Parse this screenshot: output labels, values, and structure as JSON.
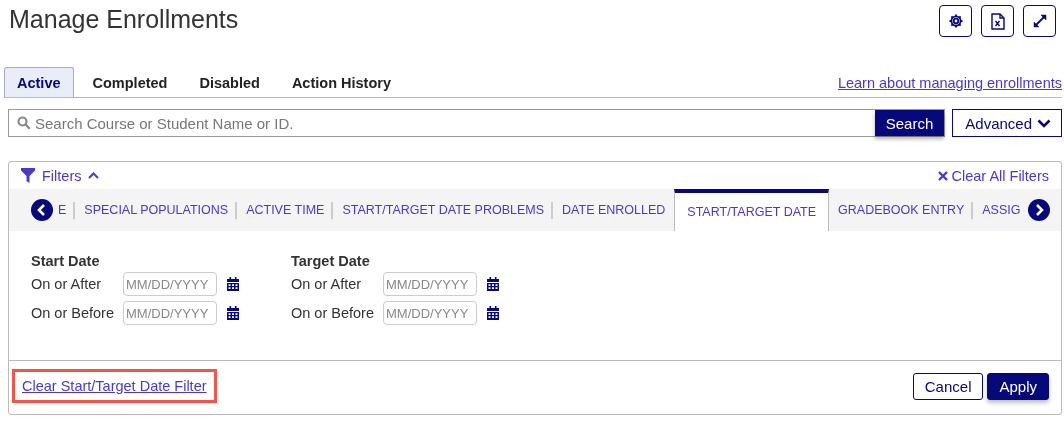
{
  "title": "Manage Enrollments",
  "toolbar": [
    {
      "kind": "settings"
    },
    {
      "kind": "excel"
    },
    {
      "kind": "expand"
    }
  ],
  "tabs": [
    {
      "label": "Active",
      "selected": true
    },
    {
      "label": "Completed",
      "selected": false
    },
    {
      "label": "Disabled",
      "selected": false
    },
    {
      "label": "Action History",
      "selected": false
    }
  ],
  "help_link": "Learn about managing enrollments",
  "search": {
    "placeholder": "Search Course or Student Name or ID.",
    "button": "Search",
    "advanced": "Advanced"
  },
  "filters": {
    "label": "Filters",
    "expanded": true,
    "clear_all": "Clear All Filters",
    "tabs": [
      {
        "label": "E",
        "selected": false
      },
      {
        "label": "SPECIAL POPULATIONS",
        "selected": false
      },
      {
        "label": "ACTIVE TIME",
        "selected": false
      },
      {
        "label": "START/TARGET DATE PROBLEMS",
        "selected": false
      },
      {
        "label": "DATE ENROLLED",
        "selected": false
      },
      {
        "label": "START/TARGET DATE",
        "selected": true
      },
      {
        "label": "GRADEBOOK ENTRY",
        "selected": false
      },
      {
        "label": "ASSIG",
        "selected": false
      }
    ],
    "groups": [
      {
        "heading": "Start Date",
        "fields": [
          {
            "label": "On or After",
            "placeholder": "MM/DD/YYYY"
          },
          {
            "label": "On or Before",
            "placeholder": "MM/DD/YYYY"
          }
        ]
      },
      {
        "heading": "Target Date",
        "fields": [
          {
            "label": "On or After",
            "placeholder": "MM/DD/YYYY"
          },
          {
            "label": "On or Before",
            "placeholder": "MM/DD/YYYY"
          }
        ]
      }
    ],
    "clear_link": {
      "label": "Clear Start/Target Date Filter",
      "highlighted": true
    },
    "buttons": [
      {
        "label": "Cancel",
        "kind": "secondary"
      },
      {
        "label": "Apply",
        "kind": "primary"
      }
    ]
  }
}
